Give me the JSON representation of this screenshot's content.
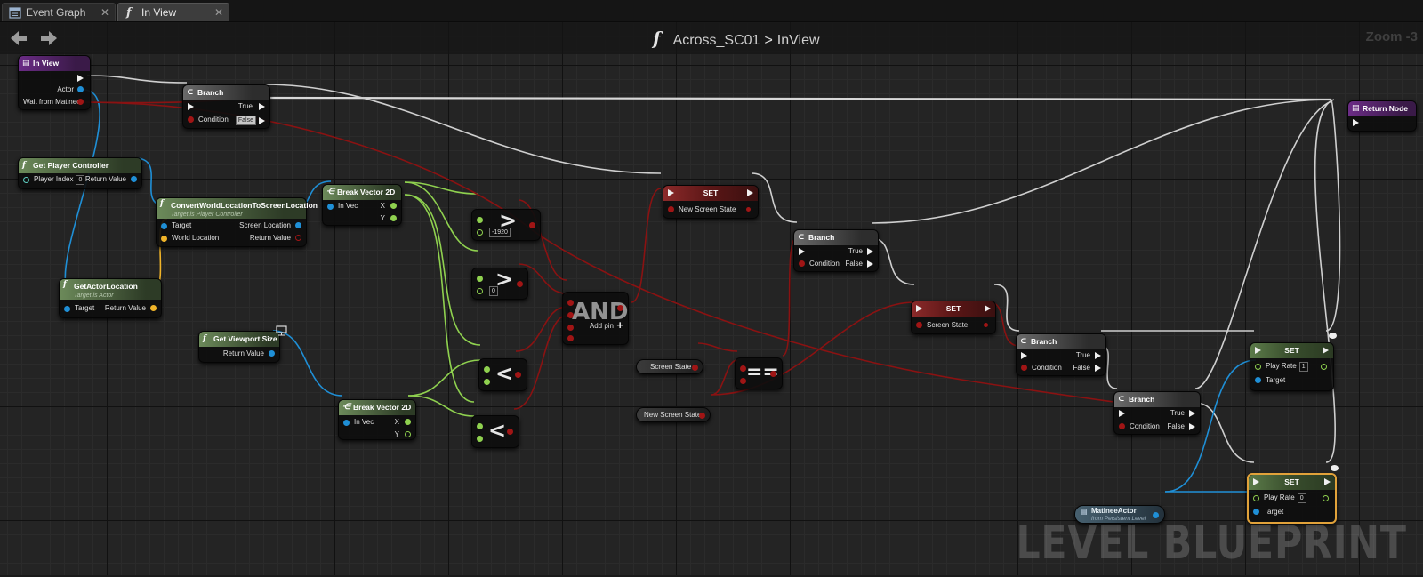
{
  "tabs": [
    {
      "label": "Event Graph",
      "icon": "event-graph-icon",
      "active": false
    },
    {
      "label": "In View",
      "icon": "function-icon",
      "active": true
    }
  ],
  "header": {
    "function_glyph": "f",
    "breadcrumb_parent": "Across_SC01",
    "separator": ">",
    "breadcrumb_current": "InView",
    "zoom": "Zoom -3"
  },
  "watermark": "LEVEL BLUEPRINT",
  "nodes": {
    "entry": {
      "title": "In View",
      "pins": [
        "Actor",
        "Wait from Matinee"
      ]
    },
    "branch1": {
      "title": "Branch",
      "condition": "Condition",
      "true": "True",
      "false": "False"
    },
    "get_player_controller": {
      "title": "Get Player Controller",
      "player_index": "Player Index",
      "player_index_value": "0",
      "return_value": "Return Value"
    },
    "convert": {
      "title": "ConvertWorldLocationToScreenLocation",
      "subtitle": "Target is Player Controller",
      "target": "Target",
      "world_location": "World Location",
      "screen_location": "Screen Location",
      "return_value": "Return Value"
    },
    "get_actor_location": {
      "title": "GetActorLocation",
      "subtitle": "Target is Actor",
      "target": "Target",
      "return_value": "Return Value"
    },
    "break_vector_1": {
      "title": "Break Vector 2D",
      "in_vec": "In Vec",
      "x": "X",
      "y": "Y"
    },
    "get_viewport_size": {
      "title": "Get Viewport Size",
      "return_value": "Return Value"
    },
    "break_vector_2": {
      "title": "Break Vector 2D",
      "in_vec": "In Vec",
      "x": "X",
      "y": "Y"
    },
    "compare_gt_1": {
      "op": ">",
      "value": "-1920"
    },
    "compare_gt_2": {
      "op": ">",
      "value": "0"
    },
    "compare_lt_1": {
      "op": "<"
    },
    "compare_lt_2": {
      "op": "<"
    },
    "and_node": {
      "op": "AND",
      "add_pin": "Add pin"
    },
    "set_new_screen_state": {
      "title": "SET",
      "var": "New Screen State"
    },
    "branch2": {
      "title": "Branch",
      "condition": "Condition",
      "true": "True",
      "false": "False"
    },
    "screen_state_getter": {
      "label": "Screen State"
    },
    "new_screen_state_getter": {
      "label": "New Screen State"
    },
    "equals_node": {
      "op": "=="
    },
    "set_screen_state": {
      "title": "SET",
      "var": "Screen State"
    },
    "branch3": {
      "title": "Branch",
      "condition": "Condition",
      "true": "True",
      "false": "False"
    },
    "branch4": {
      "title": "Branch",
      "condition": "Condition",
      "true": "True",
      "false": "False"
    },
    "set_play_rate_1": {
      "title": "SET",
      "play_rate": "Play Rate",
      "play_rate_value": "1",
      "target": "Target"
    },
    "set_play_rate_0": {
      "title": "SET",
      "play_rate": "Play Rate",
      "play_rate_value": "0",
      "target": "Target"
    },
    "matinee_actor": {
      "title": "MatineeActor",
      "subtitle": "from Persistent Level"
    },
    "return_node": {
      "title": "Return Node"
    }
  },
  "colors": {
    "exec_wire": "#cfcfcf",
    "bool_wire": "#8a1212",
    "object_wire": "#1f8fd6",
    "float_wire": "#8fd14f",
    "vector_wire": "#f0b429",
    "selected_outline": "#e1a23a"
  }
}
